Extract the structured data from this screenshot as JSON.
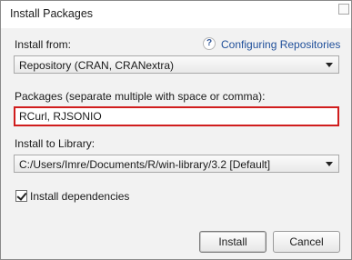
{
  "window": {
    "title": "Install Packages"
  },
  "install_from": {
    "label": "Install from:",
    "help_icon_text": "?",
    "help_link": "Configuring Repositories",
    "selected": "Repository (CRAN, CRANextra)"
  },
  "packages": {
    "label": "Packages (separate multiple with space or comma):",
    "value": "RCurl, RJSONIO",
    "highlight_color": "#d01d1d"
  },
  "library": {
    "label": "Install to Library:",
    "selected": "C:/Users/Imre/Documents/R/win-library/3.2 [Default]"
  },
  "dependencies": {
    "label": "Install dependencies",
    "checked": true
  },
  "buttons": {
    "install": "Install",
    "cancel": "Cancel"
  },
  "icons": {
    "help": "help-icon",
    "dropdown": "chevron-down-icon",
    "check": "checkmark-icon"
  }
}
